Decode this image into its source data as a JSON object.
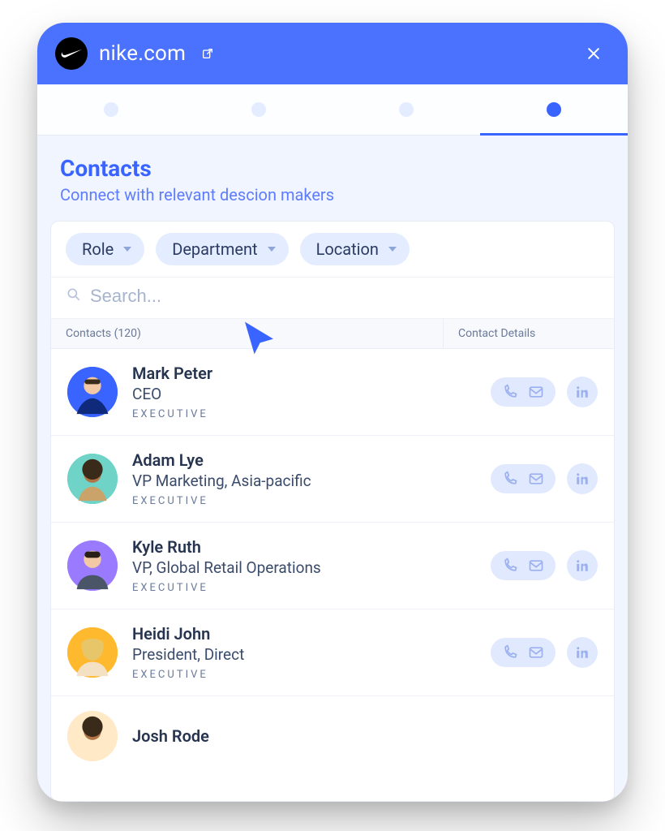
{
  "header": {
    "site": "nike.com"
  },
  "section": {
    "title": "Contacts",
    "subtitle": "Connect with relevant descion makers"
  },
  "filters": {
    "role": "Role",
    "department": "Department",
    "location": "Location"
  },
  "search": {
    "placeholder": "Search..."
  },
  "table": {
    "contacts_header": "Contacts (120)",
    "details_header": "Contact Details"
  },
  "contacts": [
    {
      "name": "Mark Peter",
      "title": "CEO",
      "tag": "EXECUTIVE"
    },
    {
      "name": "Adam Lye",
      "title": "VP Marketing, Asia-pacific",
      "tag": "EXECUTIVE"
    },
    {
      "name": "Kyle Ruth",
      "title": "VP, Global Retail Operations",
      "tag": "EXECUTIVE"
    },
    {
      "name": "Heidi John",
      "title": "President, Direct",
      "tag": "EXECUTIVE"
    },
    {
      "name": "Josh Rode",
      "title": "",
      "tag": ""
    }
  ]
}
